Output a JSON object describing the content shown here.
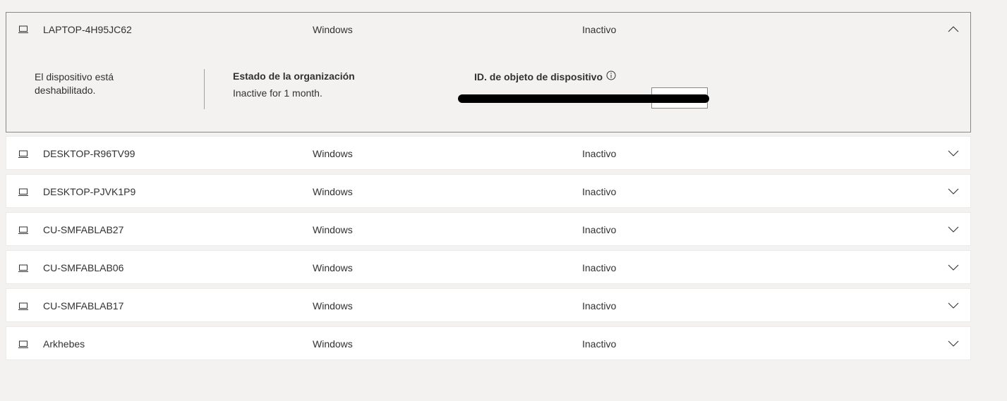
{
  "devices": [
    {
      "name": "LAPTOP-4H95JC62",
      "os": "Windows",
      "status": "Inactivo",
      "expanded": true,
      "details": {
        "disabled_note": "El dispositivo está deshabilitado.",
        "org_status_label": "Estado de la organización",
        "org_status_value": "Inactive for 1 month.",
        "object_id_label": "ID. de objeto de dispositivo"
      }
    },
    {
      "name": "DESKTOP-R96TV99",
      "os": "Windows",
      "status": "Inactivo",
      "expanded": false
    },
    {
      "name": "DESKTOP-PJVK1P9",
      "os": "Windows",
      "status": "Inactivo",
      "expanded": false
    },
    {
      "name": "CU-SMFABLAB27",
      "os": "Windows",
      "status": "Inactivo",
      "expanded": false
    },
    {
      "name": "CU-SMFABLAB06",
      "os": "Windows",
      "status": "Inactivo",
      "expanded": false
    },
    {
      "name": "CU-SMFABLAB17",
      "os": "Windows",
      "status": "Inactivo",
      "expanded": false
    },
    {
      "name": "Arkhebes",
      "os": "Windows",
      "status": "Inactivo",
      "expanded": false
    }
  ],
  "icons": {
    "device": "laptop-icon",
    "expand": "chevron-down-icon",
    "collapse": "chevron-up-icon",
    "info": "info-icon"
  },
  "colors": {
    "page_background": "#f3f2f1",
    "row_background": "#ffffff",
    "text": "#323130",
    "expanded_border": "#8a8886"
  }
}
